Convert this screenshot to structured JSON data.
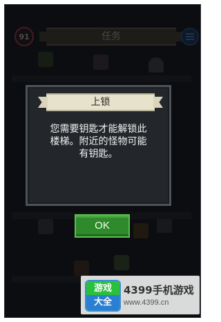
{
  "hud": {
    "level": "91",
    "title": "任务"
  },
  "dialog": {
    "title": "上锁",
    "message": "您需要钥匙才能解锁此\n楼梯。附近的怪物可能\n有钥匙。",
    "ok_label": "OK"
  },
  "watermark": {
    "badge_top": "游戏",
    "badge_bottom": "大全",
    "brand": "4399手机游戏",
    "url": "www.4399.cn"
  },
  "colors": {
    "dialog_bg": "#23272b",
    "title_banner": "#e6e2cc",
    "ok_button": "#2e8a2b"
  }
}
